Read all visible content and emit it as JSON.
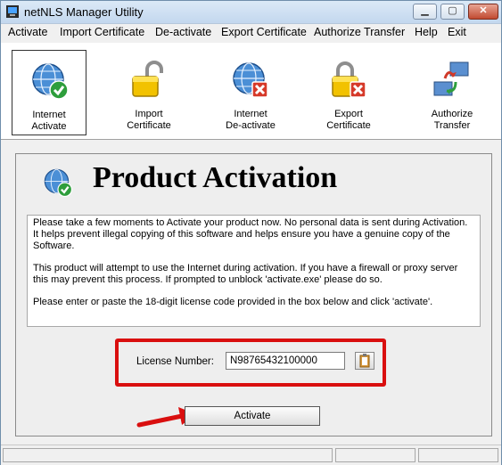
{
  "window": {
    "title": "netNLS Manager Utility"
  },
  "menu": [
    "Activate",
    "Import Certificate",
    "De-activate",
    "Export Certificate",
    "Authorize Transfer",
    "Help",
    "Exit"
  ],
  "toolbar": [
    {
      "line1": "Internet",
      "line2": "Activate",
      "icon": "globe-check-icon"
    },
    {
      "line1": "Import",
      "line2": "Certificate",
      "icon": "padlock-open-icon"
    },
    {
      "line1": "Internet",
      "line2": "De-activate",
      "icon": "globe-x-icon"
    },
    {
      "line1": "Export",
      "line2": "Certificate",
      "icon": "padlock-x-icon"
    },
    {
      "line1": "Authorize",
      "line2": "Transfer",
      "icon": "network-transfer-icon"
    }
  ],
  "panel": {
    "heading": "Product Activation",
    "paragraphs": [
      "Please take a few moments to Activate your product now.  No personal data is sent during Activation.  It helps prevent illegal copying of this software and helps ensure you have a genuine copy of the Software.",
      "This product will attempt to use the Internet during activation.  If you have a firewall or proxy server this may prevent this process.  If prompted to unblock 'activate.exe' please do so.",
      "Please enter or paste the 18-digit license code provided in the box below and click 'activate'."
    ],
    "license_label": "License Number:",
    "license_value": "N98765432100000",
    "activate_label": "Activate"
  },
  "colors": {
    "highlight": "#d90f0f",
    "accent": "#2b6cc4"
  }
}
